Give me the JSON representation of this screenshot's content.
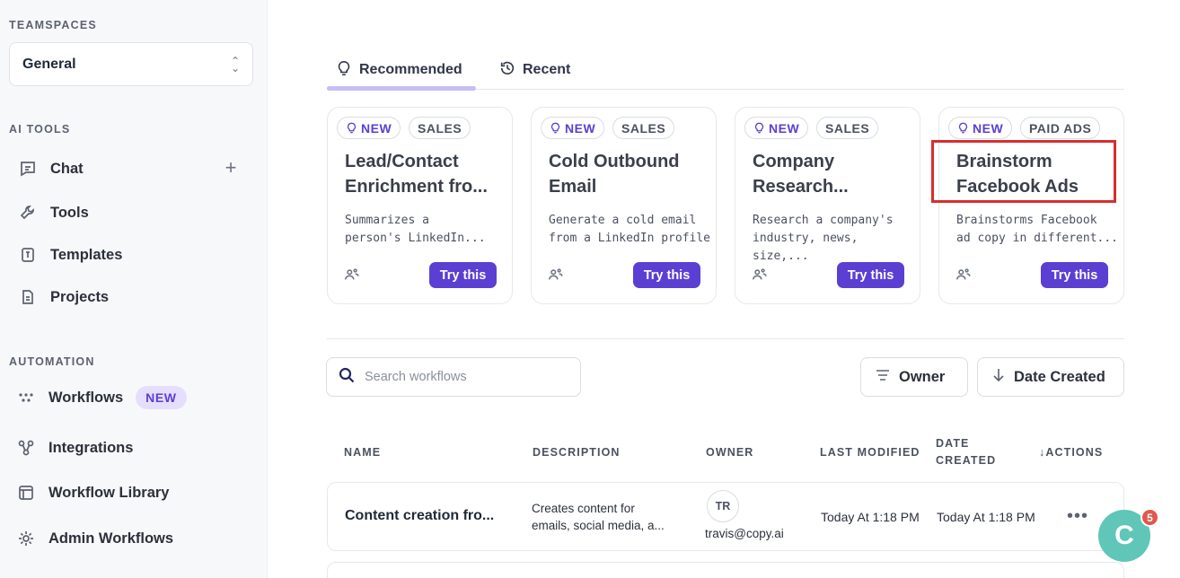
{
  "sidebar": {
    "teamspaces_label": "TEAMSPACES",
    "teamspace_value": "General",
    "ai_tools_label": "AI TOOLS",
    "ai_tools": [
      {
        "label": "Chat",
        "icon": "chat-icon"
      },
      {
        "label": "Tools",
        "icon": "wrench-icon"
      },
      {
        "label": "Templates",
        "icon": "template-icon"
      },
      {
        "label": "Projects",
        "icon": "document-icon"
      }
    ],
    "automation_label": "AUTOMATION",
    "automation": [
      {
        "label": "Workflows",
        "icon": "workflow-dots-icon",
        "badge": "NEW"
      },
      {
        "label": "Integrations",
        "icon": "integrations-icon"
      },
      {
        "label": "Workflow Library",
        "icon": "library-icon"
      },
      {
        "label": "Admin Workflows",
        "icon": "gear-icon"
      }
    ]
  },
  "tabs": [
    {
      "label": "Recommended",
      "icon": "bulb-icon",
      "active": true
    },
    {
      "label": "Recent",
      "icon": "history-icon",
      "active": false
    }
  ],
  "cards": [
    {
      "badge_new": "NEW",
      "category": "SALES",
      "title": "Lead/Contact\nEnrichment fro...",
      "description": "Summarizes a\nperson's LinkedIn...",
      "button": "Try this"
    },
    {
      "badge_new": "NEW",
      "category": "SALES",
      "title": "Cold Outbound\nEmail",
      "description": "Generate a cold email\nfrom a LinkedIn profile",
      "button": "Try this"
    },
    {
      "badge_new": "NEW",
      "category": "SALES",
      "title": "Company\nResearch...",
      "description": "Research a company's\nindustry, news, size,...",
      "button": "Try this"
    },
    {
      "badge_new": "NEW",
      "category": "PAID ADS",
      "title": "Brainstorm\nFacebook Ads",
      "description": "Brainstorms Facebook\nad copy in different...",
      "button": "Try this"
    }
  ],
  "search": {
    "placeholder": "Search workflows"
  },
  "filters": {
    "owner": "Owner",
    "date_created": "Date Created"
  },
  "table": {
    "headers": {
      "name": "NAME",
      "description": "DESCRIPTION",
      "owner": "OWNER",
      "last_modified": "LAST MODIFIED",
      "date_created": "DATE\nCREATED",
      "actions": "↓ACTIONS"
    },
    "rows": [
      {
        "name": "Content creation fro...",
        "description": "Creates content for\nemails, social media, a...",
        "owner_initials": "TR",
        "owner_email": "travis@copy.ai",
        "last_modified": "Today At 1:18 PM",
        "date_created": "Today At 1:18 PM"
      }
    ]
  },
  "chat_widget": {
    "letter": "C",
    "notifications": "5"
  },
  "colors": {
    "accent": "#5b3fd3",
    "highlight": "#d92d2d",
    "chat": "#5fc6b8"
  }
}
